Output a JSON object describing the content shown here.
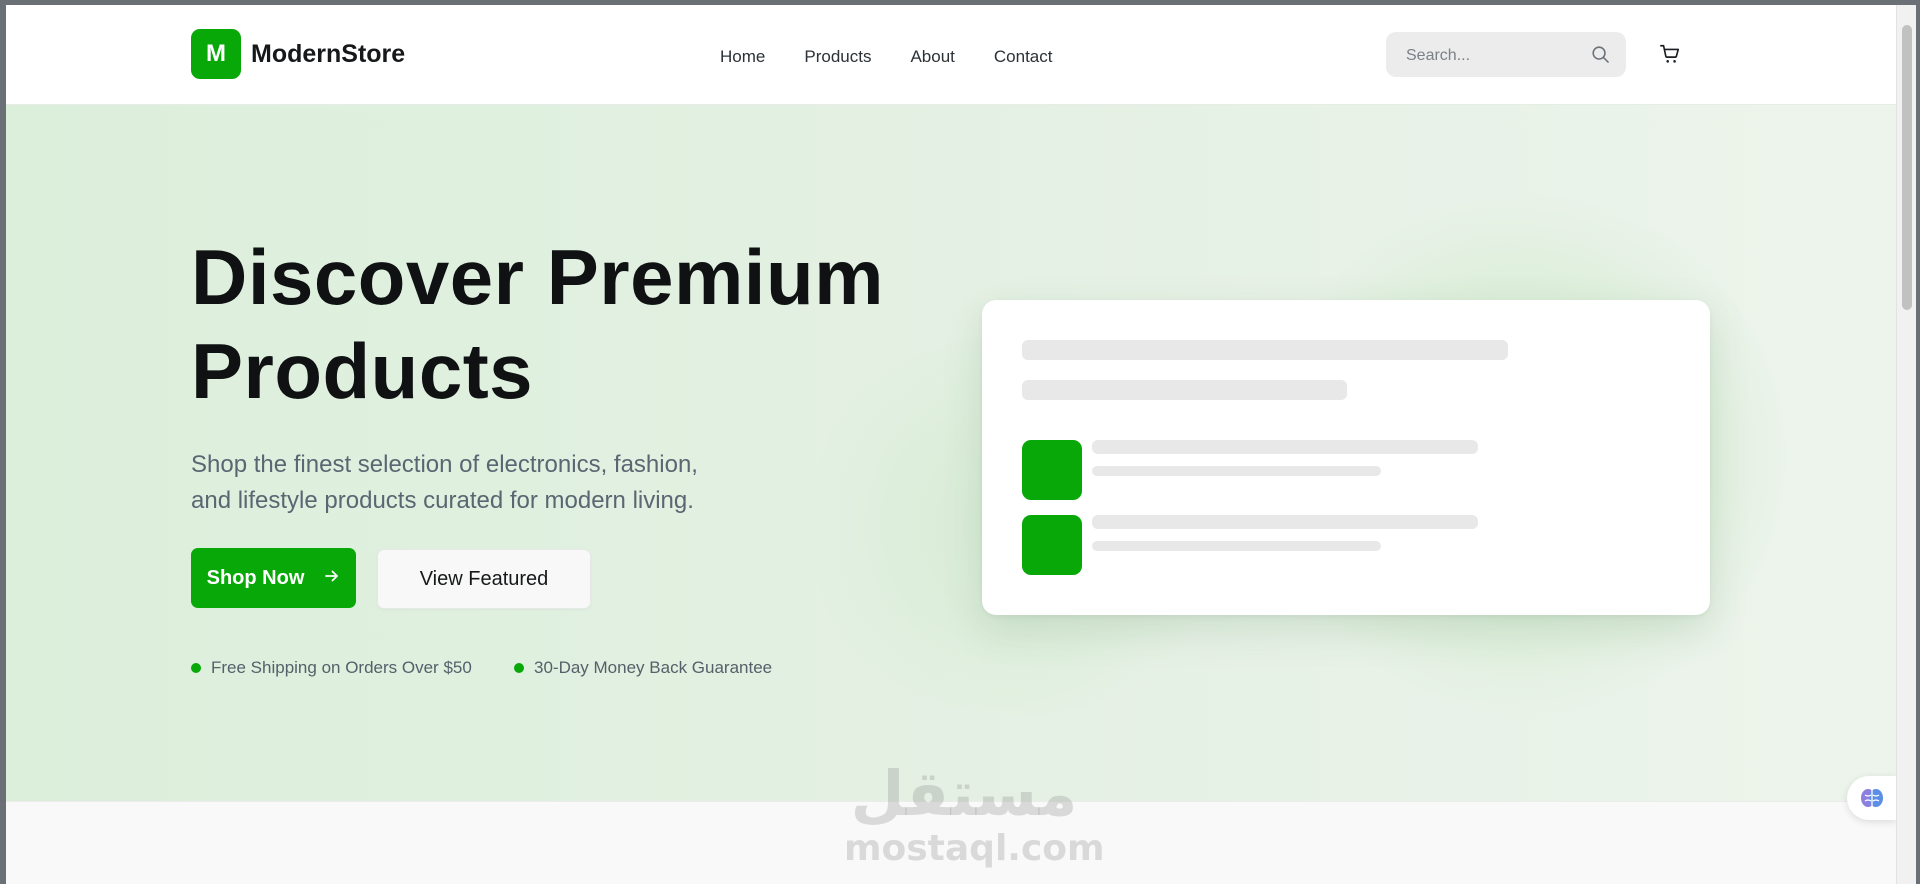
{
  "brand": {
    "logo_letter": "M",
    "name": "ModernStore",
    "accent": "#08a808"
  },
  "nav": {
    "items": [
      "Home",
      "Products",
      "About",
      "Contact"
    ]
  },
  "search": {
    "placeholder": "Search..."
  },
  "hero": {
    "title_line1": "Discover Premium",
    "title_line2": "Products",
    "subtitle_line1": "Shop the finest selection of electronics, fashion,",
    "subtitle_line2": "and lifestyle products curated for modern living.",
    "primary_button": "Shop Now",
    "secondary_button": "View Featured",
    "features": [
      "Free Shipping on Orders Over $50",
      "30-Day Money Back Guarantee"
    ]
  },
  "watermark": {
    "arabic": "مستقل",
    "latin": "mostaql.com"
  },
  "icons": {
    "search": "search-icon",
    "cart": "cart-icon",
    "arrow": "arrow-right-icon",
    "widget": "brain-icon"
  }
}
